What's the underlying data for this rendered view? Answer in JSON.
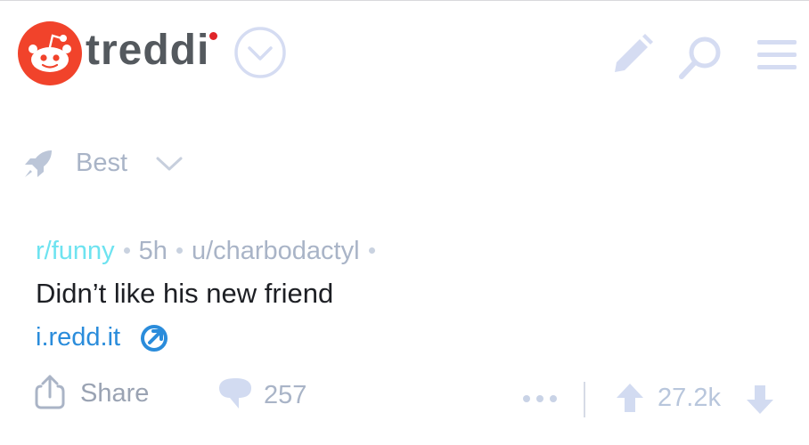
{
  "app": {
    "name": "treddi",
    "icons": {
      "logo": "reddit-alien-logo-icon",
      "switcher": "chevron-circle-icon",
      "compose": "pencil-icon",
      "search": "search-icon",
      "menu": "hamburger-menu-icon"
    },
    "colors": {
      "brand_red": "#f1432b",
      "icon_tint": "#d5dcf2",
      "link_blue": "#2a8cdb",
      "subreddit_cyan": "#6ee3f0"
    }
  },
  "sort": {
    "label": "Best",
    "icons": {
      "leading": "rocket-icon",
      "trailing": "chevron-down-icon"
    }
  },
  "post": {
    "subreddit": "r/funny",
    "age": "5h",
    "author": "u/charbodactyl",
    "title": "Didn’t like his new friend",
    "domain": "i.redd.it",
    "domain_icon": "external-link-icon",
    "actions": {
      "share_label": "Share",
      "share_icon": "share-icon",
      "comment_icon": "comment-bubble-icon",
      "comment_count": "257",
      "more_icon": "more-dots-icon",
      "upvote_icon": "upvote-arrow-icon",
      "score": "27.2k",
      "downvote_icon": "downvote-arrow-icon"
    }
  }
}
